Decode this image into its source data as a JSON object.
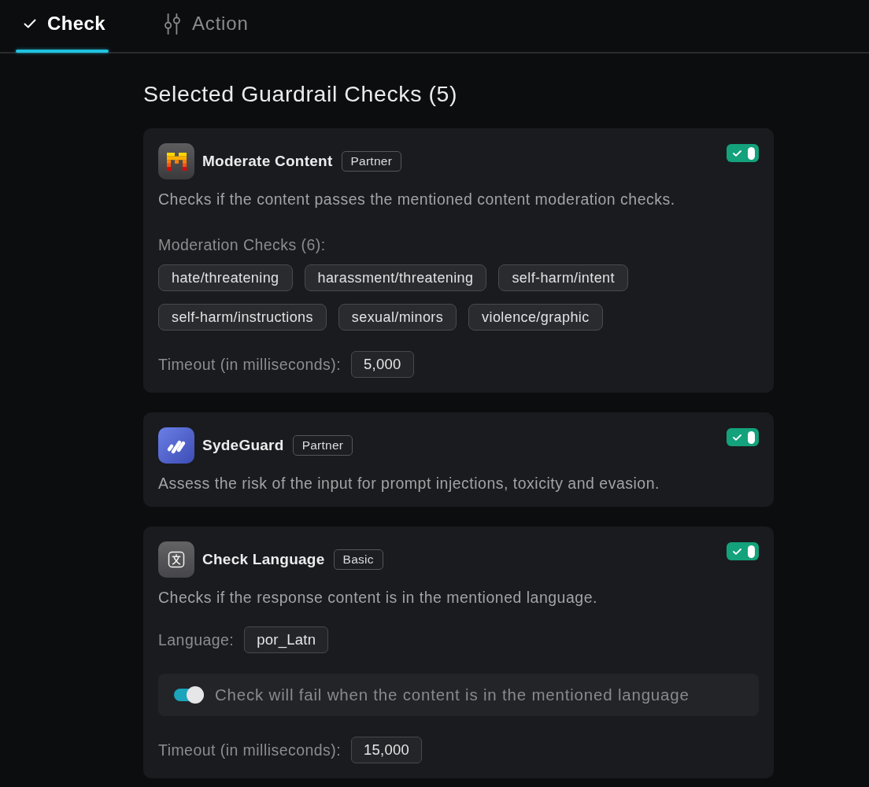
{
  "tabs": [
    {
      "kind": "tick",
      "label": "Check",
      "selected": true
    },
    {
      "kind": "sliders",
      "label": "Action",
      "selected": false
    }
  ],
  "heading": "Selected Guardrail Checks (5)",
  "checks": [
    {
      "kind": "blocks",
      "name": "Moderate Content",
      "badge": "Partner",
      "enabled": true,
      "description": "Checks if the content passes the mentioned content moderation checks.",
      "fields": [
        {
          "kind": "tags",
          "label": "Moderation Checks (6):",
          "tags": [
            "hate/threatening",
            "harassment/threatening",
            "self-harm/intent",
            "self-harm/instructions",
            "sexual/minors",
            "violence/graphic"
          ]
        },
        {
          "kind": "value",
          "label": "Timeout (in milliseconds):",
          "value": "5,000"
        }
      ]
    },
    {
      "kind": "strokes",
      "name": "SydeGuard",
      "badge": "Partner",
      "enabled": true,
      "description": "Assess the risk of the input for prompt injections, toxicity and evasion."
    },
    {
      "kind": "translate",
      "name": "Check Language",
      "badge": "Basic",
      "enabled": true,
      "description": "Checks if the response content is in the mentioned language.",
      "fields": [
        {
          "kind": "value",
          "label": "Language:",
          "value": "por_Latn"
        },
        {
          "kind": "switch",
          "label": "Check will fail when the content is in the mentioned language",
          "on": true
        },
        {
          "kind": "value",
          "label": "Timeout (in milliseconds):",
          "value": "15,000"
        }
      ]
    }
  ]
}
